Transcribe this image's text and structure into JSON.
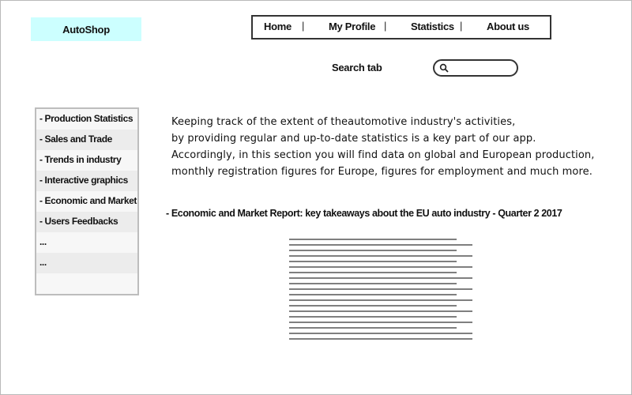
{
  "app": {
    "logo_text": "AutoShop"
  },
  "nav": {
    "items": [
      {
        "label": "Home"
      },
      {
        "label": "My Profile"
      },
      {
        "label": "Statistics"
      },
      {
        "label": "About us"
      }
    ],
    "separator": "|"
  },
  "search": {
    "label": "Search tab",
    "value": "",
    "icon": "search-icon"
  },
  "sidebar": {
    "items": [
      {
        "label": "- Production Statistics"
      },
      {
        "label": "- Sales and Trade"
      },
      {
        "label": "- Trends in industry"
      },
      {
        "label": "- Interactive graphics"
      },
      {
        "label": "- Economic and Market r"
      },
      {
        "label": "- Users Feedbacks"
      },
      {
        "label": "..."
      },
      {
        "label": "..."
      },
      {
        "label": ""
      }
    ]
  },
  "main": {
    "intro_lines": [
      "Keeping track of the extent of theautomotive industry's activities,",
      "by providing regular and up-to-date statistics is a key part of our app.",
      "Accordingly, in this section you will find data on global and European production,",
      "monthly registration figures for Europe, figures for employment and much more."
    ],
    "report_title": "- Economic and Market Report: key takeaways about the EU auto industry - Quarter 2 2017"
  },
  "colors": {
    "logo_bg": "#ccffff",
    "border": "#333333",
    "sidebar_border": "#bdbdbd"
  }
}
